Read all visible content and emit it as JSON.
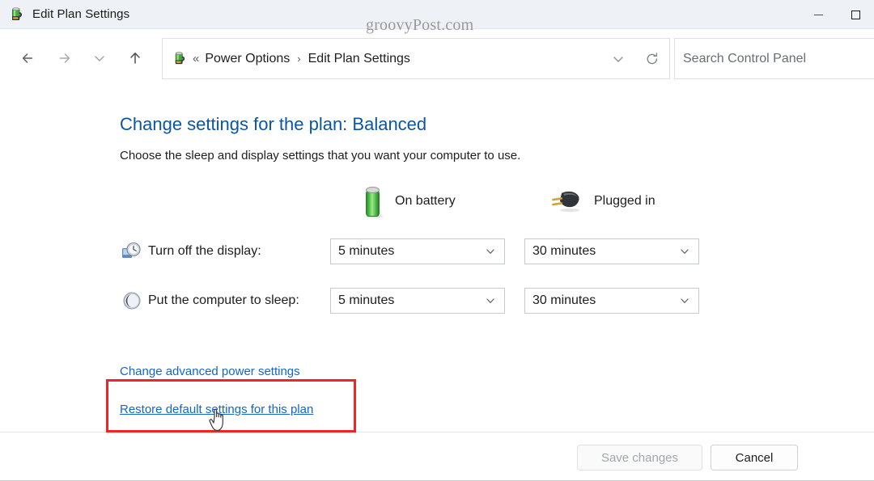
{
  "window": {
    "title": "Edit Plan Settings",
    "app_icon": "power-plan-icon",
    "minimize_label": "Minimize",
    "maximize_label": "Maximize"
  },
  "watermark": "groovyPost.com",
  "nav": {
    "back_icon": "back-arrow-icon",
    "forward_icon": "forward-arrow-icon",
    "recent_icon": "chevron-down-icon",
    "up_icon": "up-arrow-icon"
  },
  "address": {
    "icon": "power-plan-icon",
    "prefix": "«",
    "crumbs": [
      "Power Options",
      "Edit Plan Settings"
    ],
    "separator": "›",
    "dropdown_icon": "chevron-down-icon",
    "refresh_icon": "refresh-icon"
  },
  "search": {
    "placeholder": "Search Control Panel",
    "value": ""
  },
  "main": {
    "heading": "Change settings for the plan: Balanced",
    "subheading": "Choose the sleep and display settings that you want your computer to use.",
    "columns": [
      {
        "label": "On battery",
        "icon": "battery-icon"
      },
      {
        "label": "Plugged in",
        "icon": "power-plug-icon"
      }
    ],
    "rows": [
      {
        "icon": "display-clock-icon",
        "label": "Turn off the display:",
        "on_battery": "5 minutes",
        "plugged_in": "30 minutes"
      },
      {
        "icon": "sleep-moon-icon",
        "label": "Put the computer to sleep:",
        "on_battery": "5 minutes",
        "plugged_in": "30 minutes"
      }
    ],
    "links": {
      "advanced": "Change advanced power settings",
      "restore": "Restore default settings for this plan"
    }
  },
  "footer": {
    "save_label": "Save changes",
    "save_disabled": true,
    "cancel_label": "Cancel"
  },
  "annotation": {
    "highlight_color": "#f32323",
    "cursor": "hand-pointer-cursor"
  },
  "colors": {
    "titlebar_bg": "#eef1f5",
    "link": "#1266cc",
    "heading": "#0a56a4",
    "text": "#1d1d1d"
  }
}
